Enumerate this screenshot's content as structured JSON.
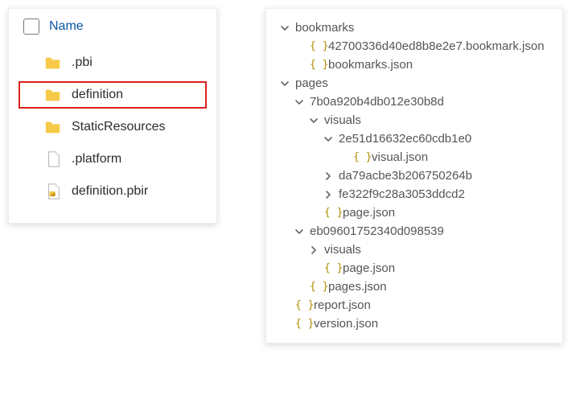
{
  "left": {
    "header": "Name",
    "items": [
      {
        "type": "folder",
        "label": ".pbi",
        "highlighted": false
      },
      {
        "type": "folder",
        "label": "definition",
        "highlighted": true
      },
      {
        "type": "folder",
        "label": "StaticResources",
        "highlighted": false
      },
      {
        "type": "file",
        "label": ".platform",
        "highlighted": false
      },
      {
        "type": "pbir",
        "label": "definition.pbir",
        "highlighted": false
      }
    ]
  },
  "tree": [
    {
      "depth": 0,
      "twisty": "open",
      "icon": "",
      "label": "bookmarks"
    },
    {
      "depth": 1,
      "twisty": "none",
      "icon": "json",
      "label": "42700336d40ed8b8e2e7.bookmark.json"
    },
    {
      "depth": 1,
      "twisty": "none",
      "icon": "json",
      "label": "bookmarks.json"
    },
    {
      "depth": 0,
      "twisty": "open",
      "icon": "",
      "label": "pages"
    },
    {
      "depth": 1,
      "twisty": "open",
      "icon": "",
      "label": "7b0a920b4db012e30b8d"
    },
    {
      "depth": 2,
      "twisty": "open",
      "icon": "",
      "label": "visuals"
    },
    {
      "depth": 3,
      "twisty": "open",
      "icon": "",
      "label": "2e51d16632ec60cdb1e0"
    },
    {
      "depth": 4,
      "twisty": "none",
      "icon": "json",
      "label": "visual.json"
    },
    {
      "depth": 3,
      "twisty": "closed",
      "icon": "",
      "label": "da79acbe3b206750264b"
    },
    {
      "depth": 3,
      "twisty": "closed",
      "icon": "",
      "label": "fe322f9c28a3053ddcd2"
    },
    {
      "depth": 2,
      "twisty": "none",
      "icon": "json",
      "label": "page.json"
    },
    {
      "depth": 1,
      "twisty": "open",
      "icon": "",
      "label": "eb09601752340d098539"
    },
    {
      "depth": 2,
      "twisty": "closed",
      "icon": "",
      "label": "visuals"
    },
    {
      "depth": 2,
      "twisty": "none",
      "icon": "json",
      "label": "page.json"
    },
    {
      "depth": 1,
      "twisty": "none",
      "icon": "json",
      "label": "pages.json"
    },
    {
      "depth": 0,
      "twisty": "none",
      "icon": "json",
      "label": "report.json"
    },
    {
      "depth": 0,
      "twisty": "none",
      "icon": "json",
      "label": "version.json"
    }
  ]
}
